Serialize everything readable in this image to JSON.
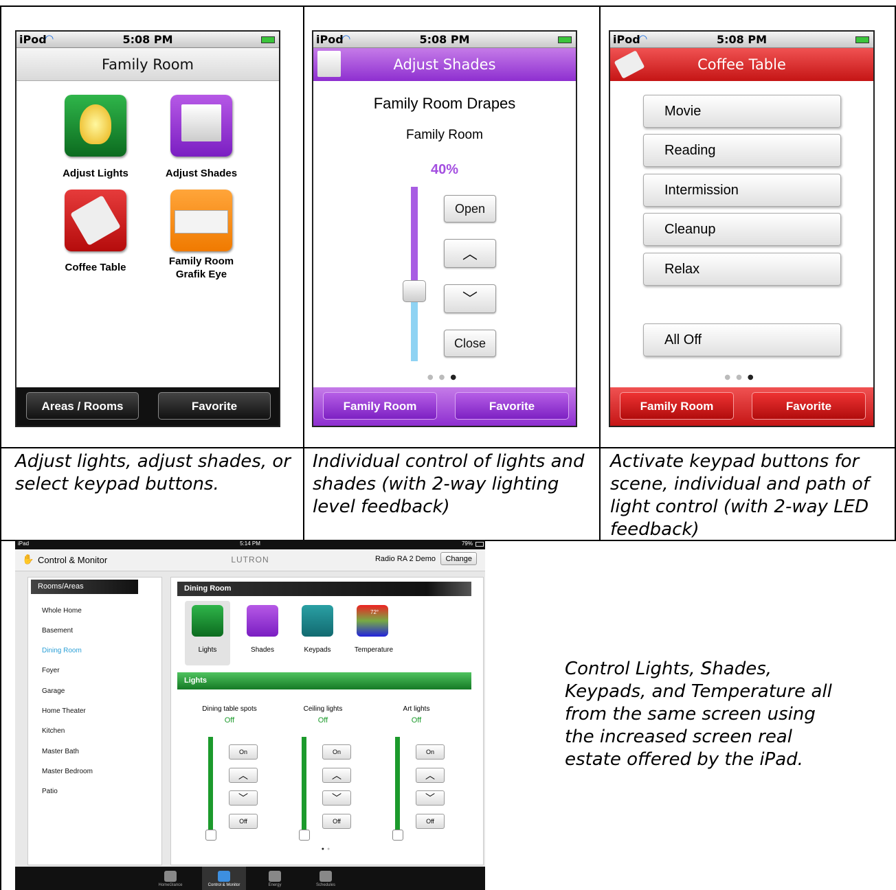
{
  "panel1": {
    "status": {
      "carrier": "iPod",
      "time": "5:08 PM"
    },
    "title": "Family Room",
    "icons": [
      {
        "label": "Adjust Lights",
        "icon": "lightbulb-icon"
      },
      {
        "label": "Adjust Shades",
        "icon": "shade-icon"
      },
      {
        "label": "Coffee Table",
        "icon": "keypad-icon"
      },
      {
        "label": "Family Room Grafik Eye",
        "icon": "grafik-eye-icon"
      }
    ],
    "bottom": {
      "left": "Areas / Rooms",
      "right": "Favorite"
    },
    "caption": "Adjust lights, adjust shades, or select keypad buttons."
  },
  "panel2": {
    "status": {
      "carrier": "iPod",
      "time": "5:08 PM"
    },
    "title": "Adjust Shades",
    "device": "Family Room Drapes",
    "area": "Family Room",
    "level": "40%",
    "level_value": 0.4,
    "buttons": {
      "open": "Open",
      "close": "Close",
      "up": "︿",
      "down": "﹀"
    },
    "bottom": {
      "left": "Family Room",
      "right": "Favorite"
    },
    "caption": "Individual control of lights and shades (with 2-way lighting level feedback)"
  },
  "panel3": {
    "status": {
      "carrier": "iPod",
      "time": "5:08 PM"
    },
    "title": "Coffee Table",
    "scenes": [
      "Movie",
      "Reading",
      "Intermission",
      "Cleanup",
      "Relax"
    ],
    "all_off": "All Off",
    "bottom": {
      "left": "Family Room",
      "right": "Favorite"
    },
    "caption": "Activate keypad buttons for scene, individual and path of light control (with 2-way LED feedback)"
  },
  "ipad": {
    "status": {
      "carrier": "iPad",
      "time": "5:14 PM",
      "battery": "79%"
    },
    "header": {
      "title": "Control & Monitor",
      "brand": "LUTRON",
      "system": "Radio RA 2 Demo",
      "change": "Change"
    },
    "rooms_title": "Rooms/Areas",
    "rooms": [
      "Whole Home",
      "Basement",
      "Dining Room",
      "Foyer",
      "Garage",
      "Home Theater",
      "Kitchen",
      "Master Bath",
      "Master Bedroom",
      "Patio"
    ],
    "selected_room": "Dining Room",
    "room_title": "Dining Room",
    "categories": [
      "Lights",
      "Shades",
      "Keypads",
      "Temperature"
    ],
    "temperature": "72°",
    "section": "Lights",
    "lights": [
      {
        "name": "Dining table spots",
        "state": "Off"
      },
      {
        "name": "Ceiling lights",
        "state": "Off"
      },
      {
        "name": "Art lights",
        "state": "Off"
      }
    ],
    "btn": {
      "on": "On",
      "off": "Off"
    },
    "tabs": [
      "HomeGlance",
      "Control & Monitor",
      "Energy",
      "Schedules"
    ]
  },
  "ipad_caption": "Control Lights, Shades, Keypads, and Temperature all from the same screen using the increased screen real estate offered by the iPad.",
  "colors": {
    "purple": "#8e2fd0",
    "red": "#c51515",
    "green": "#1c9a2c",
    "selected_room": "#2a9fd6"
  }
}
